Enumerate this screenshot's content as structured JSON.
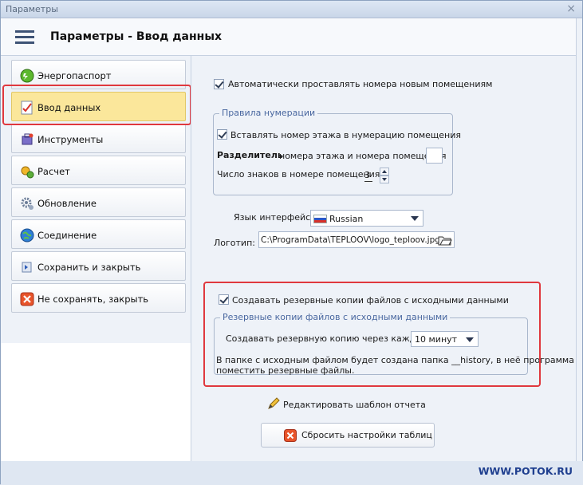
{
  "window": {
    "title": "Параметры",
    "close_glyph": "×"
  },
  "header": {
    "caption": "Параметры  -  Ввод данных",
    "menu_icon": "hamburger-icon"
  },
  "sidebar": {
    "items": [
      {
        "label": "Энергопаспорт",
        "icon": "energy-icon",
        "active": false
      },
      {
        "label": "Ввод данных",
        "icon": "data-input-icon",
        "active": true
      },
      {
        "label": "Инструменты",
        "icon": "tools-icon",
        "active": false
      },
      {
        "label": "Расчет",
        "icon": "calculate-icon",
        "active": false
      },
      {
        "label": "Обновление",
        "icon": "update-icon",
        "active": false
      },
      {
        "label": "Соединение",
        "icon": "globe-icon",
        "active": false
      },
      {
        "label": "Сохранить и закрыть",
        "icon": "save-close-icon",
        "active": false
      },
      {
        "label": "Не сохранять, закрыть",
        "icon": "cancel-close-icon",
        "active": false
      }
    ]
  },
  "main": {
    "auto_number": {
      "label": "Автоматически проставлять номера новым помещениям",
      "checked": true
    },
    "numbering_group": {
      "legend": "Правила нумерации",
      "insert_floor": {
        "label": "Вставлять номер этажа в нумерацию помещения",
        "checked": true
      },
      "separator_bold": "Разделитель",
      "separator_rest": "номера этажа и номера помещения",
      "separator_value": "",
      "digits_label": "Число знаков в номере помещения",
      "digits_value": "3"
    },
    "language": {
      "label": "Язык интерфейса",
      "value": "Russian"
    },
    "logo": {
      "label": "Логотип:",
      "value": "C:\\ProgramData\\TEPLOOV\\logo_teploov.jpg"
    },
    "backup": {
      "enable": {
        "label": "Создавать резервные копии файлов с исходными данными",
        "checked": true
      },
      "legend": "Резервные копии файлов с исходными данными",
      "interval_label": "Создавать резервную копию через каждые",
      "interval_value": "10 минут",
      "note_line1": "В папке с исходным файлом будет создана папка __history, в неё программа",
      "note_line2": "поместить резервные файлы."
    },
    "edit_template": "Редактировать шаблон отчета",
    "reset_tables": "Сбросить настройки таблиц"
  },
  "watermark": "WWW.POTOK.RU",
  "colors": {
    "highlight_red": "#e0383e",
    "active_item": "#fbe79b",
    "legend_blue": "#4a68a0"
  }
}
